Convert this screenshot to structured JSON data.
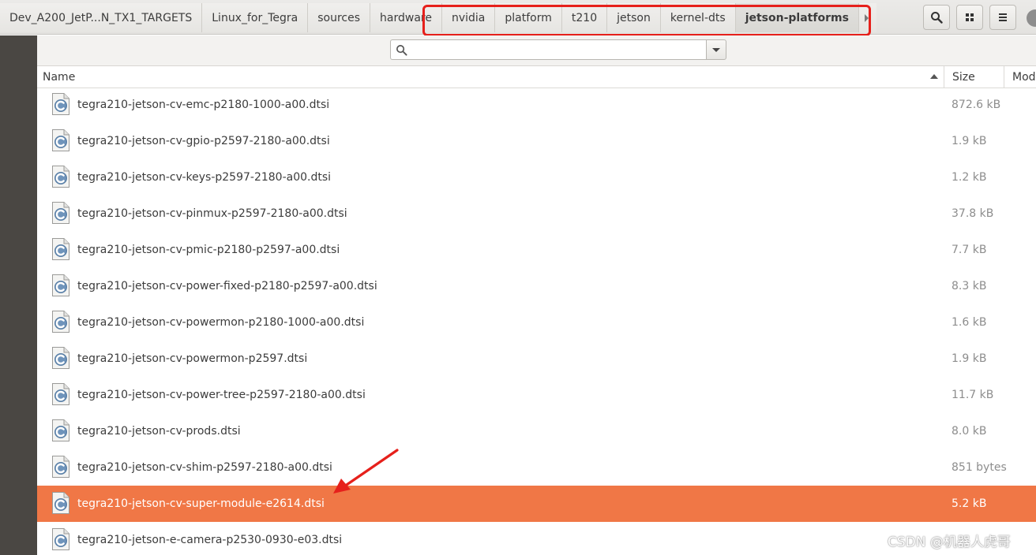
{
  "breadcrumbs": [
    {
      "label": "Dev_A200_JetP...N_TX1_TARGETS",
      "active": false
    },
    {
      "label": "Linux_for_Tegra",
      "active": false
    },
    {
      "label": "sources",
      "active": false
    },
    {
      "label": "hardware",
      "active": false
    },
    {
      "label": "nvidia",
      "active": false
    },
    {
      "label": "platform",
      "active": false
    },
    {
      "label": "t210",
      "active": false
    },
    {
      "label": "jetson",
      "active": false
    },
    {
      "label": "kernel-dts",
      "active": false
    },
    {
      "label": "jetson-platforms",
      "active": true
    }
  ],
  "header_icons": [
    "search-icon",
    "grid-view-icon",
    "hamburger-menu-icon"
  ],
  "search": {
    "value": "",
    "placeholder": ""
  },
  "columns": {
    "name": "Name",
    "size": "Size",
    "modified": "Mod"
  },
  "files": [
    {
      "name": "tegra210-jetson-cv-emc-p2180-1000-a00.dtsi",
      "size": "872.6 kB",
      "selected": false
    },
    {
      "name": "tegra210-jetson-cv-gpio-p2597-2180-a00.dtsi",
      "size": "1.9 kB",
      "selected": false
    },
    {
      "name": "tegra210-jetson-cv-keys-p2597-2180-a00.dtsi",
      "size": "1.2 kB",
      "selected": false
    },
    {
      "name": "tegra210-jetson-cv-pinmux-p2597-2180-a00.dtsi",
      "size": "37.8 kB",
      "selected": false
    },
    {
      "name": "tegra210-jetson-cv-pmic-p2180-p2597-a00.dtsi",
      "size": "7.7 kB",
      "selected": false
    },
    {
      "name": "tegra210-jetson-cv-power-fixed-p2180-p2597-a00.dtsi",
      "size": "8.3 kB",
      "selected": false
    },
    {
      "name": "tegra210-jetson-cv-powermon-p2180-1000-a00.dtsi",
      "size": "1.6 kB",
      "selected": false
    },
    {
      "name": "tegra210-jetson-cv-powermon-p2597.dtsi",
      "size": "1.9 kB",
      "selected": false
    },
    {
      "name": "tegra210-jetson-cv-power-tree-p2597-2180-a00.dtsi",
      "size": "11.7 kB",
      "selected": false
    },
    {
      "name": "tegra210-jetson-cv-prods.dtsi",
      "size": "8.0 kB",
      "selected": false
    },
    {
      "name": "tegra210-jetson-cv-shim-p2597-2180-a00.dtsi",
      "size": "851 bytes",
      "selected": false
    },
    {
      "name": "tegra210-jetson-cv-super-module-e2614.dtsi",
      "size": "5.2 kB",
      "selected": true
    },
    {
      "name": "tegra210-jetson-e-camera-p2530-0930-e03.dtsi",
      "size": "",
      "selected": false
    }
  ],
  "file_icon": "c-source-file-icon",
  "colors": {
    "selection": "#f07746",
    "annotation": "#e6201b",
    "sidebar": "#4a4743"
  },
  "watermark": "CSDN @机器人虎哥"
}
